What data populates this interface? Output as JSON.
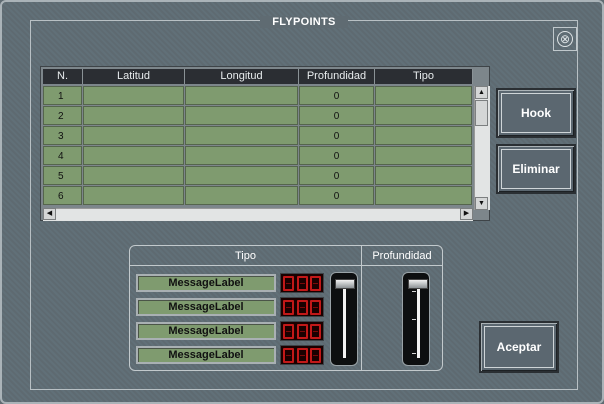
{
  "window": {
    "title": "FLYPOINTS",
    "close_glyph": "⊗"
  },
  "table": {
    "columns": [
      "N.",
      "Latitud",
      "Longitud",
      "Profundidad",
      "Tipo"
    ],
    "rows": [
      {
        "n": "1",
        "latitud": "",
        "longitud": "",
        "profundidad": "0",
        "tipo": ""
      },
      {
        "n": "2",
        "latitud": "",
        "longitud": "",
        "profundidad": "0",
        "tipo": ""
      },
      {
        "n": "3",
        "latitud": "",
        "longitud": "",
        "profundidad": "0",
        "tipo": ""
      },
      {
        "n": "4",
        "latitud": "",
        "longitud": "",
        "profundidad": "0",
        "tipo": ""
      },
      {
        "n": "5",
        "latitud": "",
        "longitud": "",
        "profundidad": "0",
        "tipo": ""
      },
      {
        "n": "6",
        "latitud": "",
        "longitud": "",
        "profundidad": "0",
        "tipo": ""
      }
    ],
    "scroll_up": "▲",
    "scroll_down": "▼",
    "scroll_left": "◀",
    "scroll_right": "▶"
  },
  "buttons": {
    "hook": "Hook",
    "eliminar": "Eliminar",
    "aceptar": "Aceptar"
  },
  "panel": {
    "tipo_header": "Tipo",
    "profundidad_header": "Profundidad",
    "labels": [
      "MessageLabel",
      "MessageLabel",
      "MessageLabel",
      "MessageLabel"
    ]
  },
  "colors": {
    "background": "#5f6b72",
    "cell_green": "#7f9b6f",
    "header_dark": "#2b2e33",
    "led_red": "#c21818"
  }
}
